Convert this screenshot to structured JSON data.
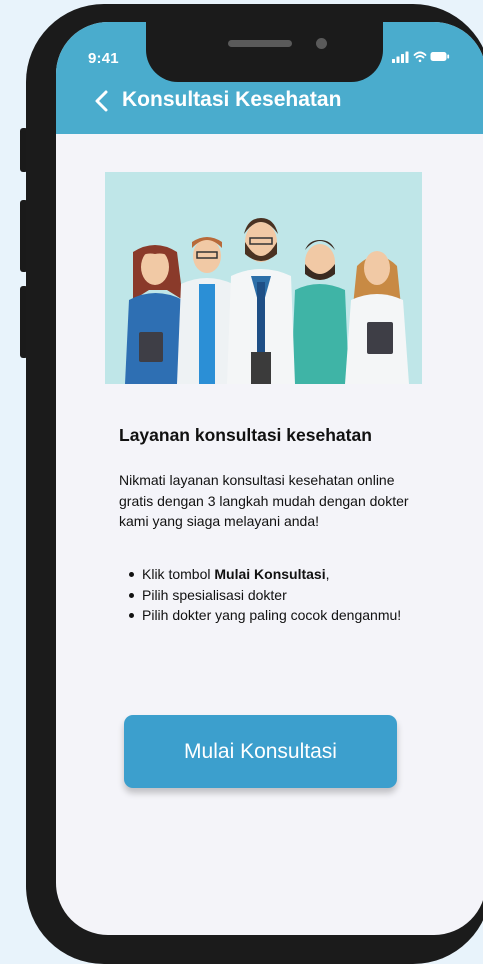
{
  "status_bar": {
    "time": "9:41"
  },
  "header": {
    "title": "Konsultasi Kesehatan"
  },
  "colors": {
    "header": "#4aaccd",
    "button": "#3c9fcd",
    "illustration_bg": "#bfe6e8"
  },
  "icons": {
    "back": "chevron-left-icon",
    "signal": "signal-icon",
    "wifi": "wifi-icon",
    "battery": "battery-icon"
  },
  "content": {
    "heading": "Layanan konsultasi kesehatan",
    "description": "Nikmati layanan konsultasi kesehatan online gratis dengan 3 langkah mudah dengan dokter kami yang siaga melayani anda!",
    "steps": [
      {
        "prefix": "Klik tombol ",
        "bold": "Mulai Konsultasi",
        "suffix": ","
      },
      {
        "text": "Pilih spesialisasi dokter"
      },
      {
        "text": "Pilih dokter yang paling cocok denganmu!"
      }
    ]
  },
  "cta": {
    "label": "Mulai Konsultasi"
  }
}
